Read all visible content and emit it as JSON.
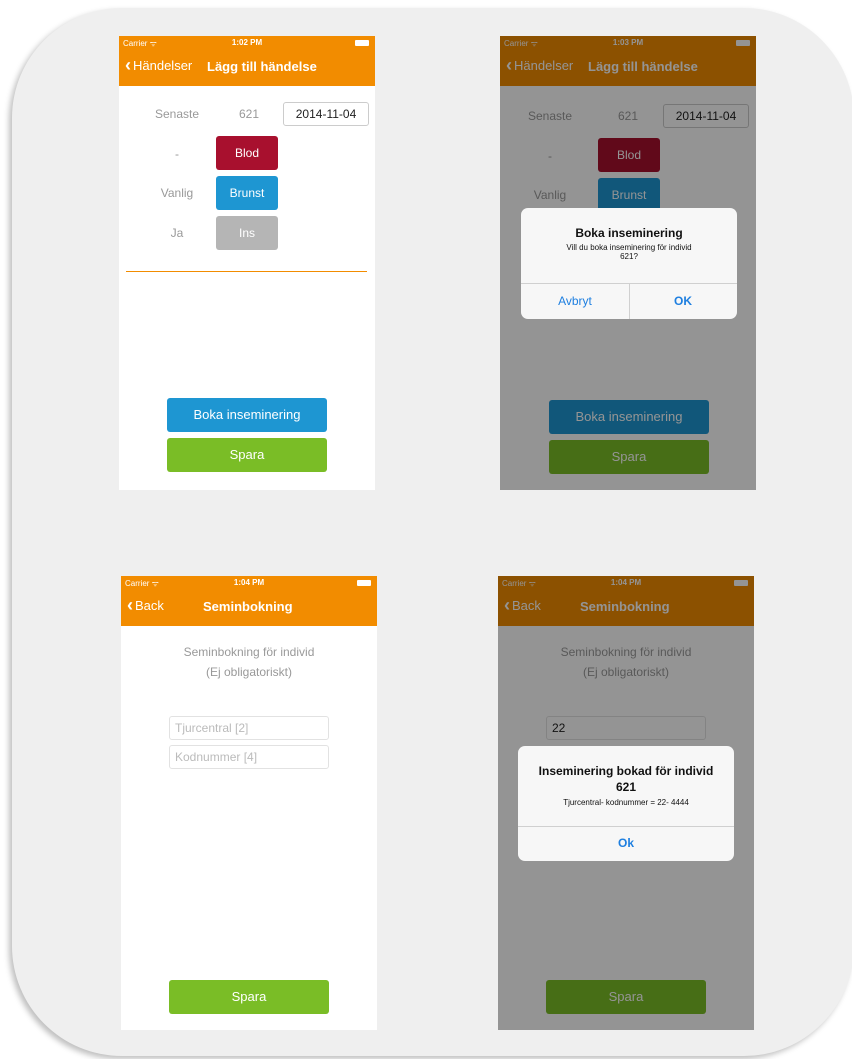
{
  "screen1": {
    "carrier": "Carrier ᯤ",
    "time": "1:02 PM",
    "back_label": "Händelser",
    "title": "Lägg till händelse",
    "senaste_label": "Senaste",
    "individ": "621",
    "date": "2014-11-04",
    "row_labels": [
      "-",
      "Vanlig",
      "Ja"
    ],
    "chip_labels": [
      "Blod",
      "Brunst",
      "Ins"
    ],
    "boka_button": "Boka inseminering",
    "spara_button": "Spara"
  },
  "screen2": {
    "carrier": "Carrier ᯤ",
    "time": "1:03 PM",
    "back_label": "Händelser",
    "title": "Lägg till händelse",
    "senaste_label": "Senaste",
    "individ": "621",
    "date": "2014-11-04",
    "row_labels": [
      "-",
      "Vanlig"
    ],
    "chip_labels": [
      "Blod",
      "Brunst"
    ],
    "boka_button": "Boka inseminering",
    "spara_button": "Spara",
    "alert": {
      "title": "Boka inseminering",
      "message_line1": "Vill du boka inseminering för individ",
      "message_line2": "621?",
      "cancel": "Avbryt",
      "ok": "OK"
    }
  },
  "screen3": {
    "carrier": "Carrier ᯤ",
    "time": "1:04 PM",
    "back_label": "Back",
    "title": "Seminbokning",
    "heading_line1": "Seminbokning för individ",
    "heading_line2": "(Ej obligatoriskt)",
    "tjurcentral_placeholder": "Tjurcentral [2]",
    "kodnummer_placeholder": "Kodnummer [4]",
    "spara_button": "Spara"
  },
  "screen4": {
    "carrier": "Carrier ᯤ",
    "time": "1:04 PM",
    "back_label": "Back",
    "title": "Seminbokning",
    "heading_line1": "Seminbokning för individ",
    "heading_line2": "(Ej obligatoriskt)",
    "tjurcentral_value": "22",
    "spara_button": "Spara",
    "alert": {
      "title_line1": "Inseminering bokad för individ",
      "title_line2": "621",
      "message": "Tjurcentral- kodnummer =  22- 4444",
      "ok": "Ok"
    }
  },
  "colors": {
    "navbar": "#f28c00",
    "blue": "#1e96d2",
    "green": "#7abd26",
    "red": "#a8102e",
    "gray": "#b5b5b5",
    "alert_link": "#1e7fe0"
  }
}
